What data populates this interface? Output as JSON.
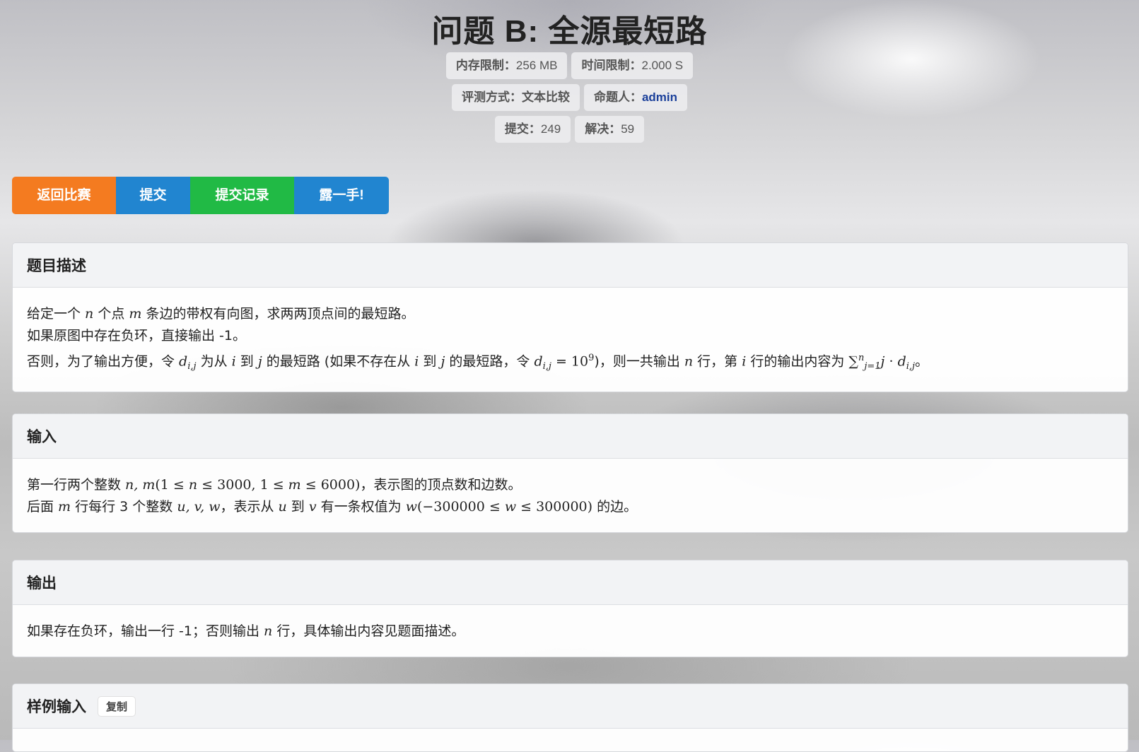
{
  "title": "问题 B: 全源最短路",
  "meta": {
    "memory_key": "内存限制：",
    "memory_val": "256 MB",
    "time_key": "时间限制：",
    "time_val": "2.000 S",
    "judge_key": "评测方式：",
    "judge_val": "文本比较",
    "author_key": "命题人：",
    "author_val": "admin",
    "submit_key": "提交：",
    "submit_val": "249",
    "solve_key": "解决：",
    "solve_val": "59"
  },
  "buttons": {
    "back": "返回比赛",
    "submit": "提交",
    "records": "提交记录",
    "show": "露一手!"
  },
  "colors": {
    "orange": "#f47b20",
    "blue": "#2185d0",
    "green": "#21ba45",
    "link": "#1a3f9a"
  },
  "description": {
    "heading": "题目描述",
    "l1_a": "给定一个 ",
    "l1_n": "n",
    "l1_b": " 个点 ",
    "l1_m": "m",
    "l1_c": " 条边的带权有向图，求两两顶点间的最短路。",
    "l2": "如果原图中存在负环，直接输出 -1。",
    "l3_a": "否则，为了输出方便，令 ",
    "l3_d": "d",
    "l3_sub": "i,j",
    "l3_b": " 为从 ",
    "l3_i": "i",
    "l3_c": " 到 ",
    "l3_j": "j",
    "l3_d2": " 的最短路 (如果不存在从 ",
    "l3_i2": "i",
    "l3_e": " 到 ",
    "l3_j2": "j",
    "l3_f": " 的最短路，令 ",
    "l3_dd": "d",
    "l3_sub2": "i,j",
    "l3_eq": " = 10",
    "l3_sup": "9",
    "l3_g": ")，则一共输出 ",
    "l3_n": "n",
    "l3_h": " 行，第 ",
    "l3_i3": "i",
    "l3_k": " 行的输出内容为 ",
    "l3_sum": "∑",
    "l3_sum_sup": "n",
    "l3_sum_sub": "j=1",
    "l3_j3": "j",
    "l3_dot": " · ",
    "l3_d3": "d",
    "l3_sub3": "i,j",
    "l3_end": "。"
  },
  "input": {
    "heading": "输入",
    "l1_a": "第一行两个整数 ",
    "l1_math": "n, m",
    "l1_b": "(1 ≤ ",
    "l1_n": "n",
    "l1_c": " ≤ 3000, 1 ≤ ",
    "l1_m": "m",
    "l1_d": " ≤ 6000)",
    "l1_e": "，表示图的顶点数和边数。",
    "l2_a": "后面 ",
    "l2_m": "m",
    "l2_b": " 行每行 3 个整数 ",
    "l2_uvw": "u, v, w",
    "l2_c": "，表示从 ",
    "l2_u": "u",
    "l2_d": " 到 ",
    "l2_v": "v",
    "l2_e": " 有一条权值为 ",
    "l2_w": "w",
    "l2_f": "(−300000 ≤ ",
    "l2_w2": "w",
    "l2_g": " ≤ 300000)",
    "l2_h": " 的边。"
  },
  "output": {
    "heading": "输出",
    "l1_a": "如果存在负环，输出一行 -1；否则输出 ",
    "l1_n": "n",
    "l1_b": " 行，具体输出内容见题面描述。"
  },
  "sample_input": {
    "heading": "样例输入",
    "copy": "复制"
  }
}
